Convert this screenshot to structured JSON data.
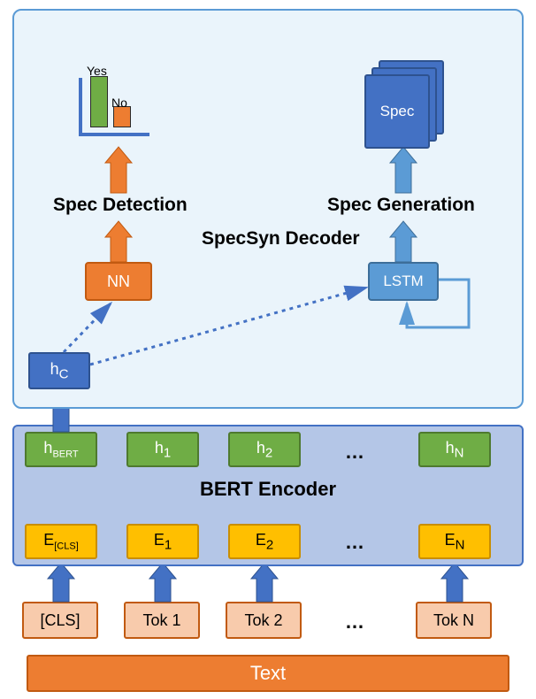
{
  "chart_data": {
    "type": "diagram",
    "title": "SpecSyn architecture (BERT Encoder + SpecSyn Decoder)",
    "nodes": [
      {
        "id": "text",
        "label": "Text",
        "layer": "input"
      },
      {
        "id": "tok_cls",
        "label": "[CLS]",
        "layer": "tokens"
      },
      {
        "id": "tok_1",
        "label": "Tok 1",
        "layer": "tokens"
      },
      {
        "id": "tok_2",
        "label": "Tok 2",
        "layer": "tokens"
      },
      {
        "id": "tok_dots",
        "label": "...",
        "layer": "tokens"
      },
      {
        "id": "tok_n",
        "label": "Tok N",
        "layer": "tokens"
      },
      {
        "id": "e_cls",
        "label": "E_[CLS]",
        "layer": "embeddings"
      },
      {
        "id": "e_1",
        "label": "E_1",
        "layer": "embeddings"
      },
      {
        "id": "e_2",
        "label": "E_2",
        "layer": "embeddings"
      },
      {
        "id": "e_dots",
        "label": "...",
        "layer": "embeddings"
      },
      {
        "id": "e_n",
        "label": "E_N",
        "layer": "embeddings"
      },
      {
        "id": "bert_enc",
        "label": "BERT Encoder",
        "layer": "encoder"
      },
      {
        "id": "h_bert",
        "label": "h_BERT",
        "layer": "hidden"
      },
      {
        "id": "h_1",
        "label": "h_1",
        "layer": "hidden"
      },
      {
        "id": "h_2",
        "label": "h_2",
        "layer": "hidden"
      },
      {
        "id": "h_dots",
        "label": "...",
        "layer": "hidden"
      },
      {
        "id": "h_n",
        "label": "h_N",
        "layer": "hidden"
      },
      {
        "id": "h_c",
        "label": "h_C",
        "layer": "decoder"
      },
      {
        "id": "nn",
        "label": "NN",
        "layer": "decoder"
      },
      {
        "id": "lstm",
        "label": "LSTM",
        "layer": "decoder"
      },
      {
        "id": "decoder_box",
        "label": "SpecSyn Decoder",
        "layer": "decoder"
      },
      {
        "id": "spec_det",
        "label": "Spec Detection",
        "layer": "output"
      },
      {
        "id": "spec_gen",
        "label": "Spec Generation",
        "layer": "output"
      },
      {
        "id": "spec_doc",
        "label": "Spec",
        "layer": "output"
      },
      {
        "id": "chart_yes",
        "label": "Yes",
        "layer": "output"
      },
      {
        "id": "chart_no",
        "label": "No",
        "layer": "output"
      }
    ],
    "edges": [
      {
        "from": "text",
        "to": "tok_cls",
        "style": "implicit"
      },
      {
        "from": "tok_cls",
        "to": "e_cls",
        "style": "solid"
      },
      {
        "from": "tok_1",
        "to": "e_1",
        "style": "solid"
      },
      {
        "from": "tok_2",
        "to": "e_2",
        "style": "solid"
      },
      {
        "from": "tok_n",
        "to": "e_n",
        "style": "solid"
      },
      {
        "from": "h_bert",
        "to": "h_c",
        "style": "solid"
      },
      {
        "from": "h_c",
        "to": "nn",
        "style": "dashed"
      },
      {
        "from": "h_c",
        "to": "lstm",
        "style": "dashed"
      },
      {
        "from": "nn",
        "to": "spec_det",
        "style": "solid"
      },
      {
        "from": "lstm",
        "to": "spec_gen",
        "style": "solid"
      },
      {
        "from": "lstm",
        "to": "lstm",
        "style": "self-loop"
      }
    ],
    "mini_chart": {
      "type": "bar",
      "categories": [
        "Yes",
        "No"
      ],
      "values": [
        1.0,
        0.35
      ],
      "ylim": [
        0,
        1
      ],
      "note": "relative bar heights only; no numeric axis shown in image"
    }
  },
  "labels": {
    "text": "Text",
    "cls": "[CLS]",
    "tok1": "Tok 1",
    "tok2": "Tok 2",
    "tokn": "Tok N",
    "ecls_pre": "E",
    "ecls_sub": "[CLS]",
    "e1_pre": "E",
    "e1_sub": "1",
    "e2_pre": "E",
    "e2_sub": "2",
    "en_pre": "E",
    "en_sub": "N",
    "bert": "BERT Encoder",
    "hbert_pre": "h",
    "hbert_sub": "BERT",
    "h1_pre": "h",
    "h1_sub": "1",
    "h2_pre": "h",
    "h2_sub": "2",
    "hn_pre": "h",
    "hn_sub": "N",
    "hc_pre": "h",
    "hc_sub": "C",
    "nn": "NN",
    "lstm": "LSTM",
    "decoder": "SpecSyn Decoder",
    "spec_det": "Spec Detection",
    "spec_gen": "Spec Generation",
    "spec": "Spec",
    "yes": "Yes",
    "no": "No",
    "dots": "…"
  }
}
